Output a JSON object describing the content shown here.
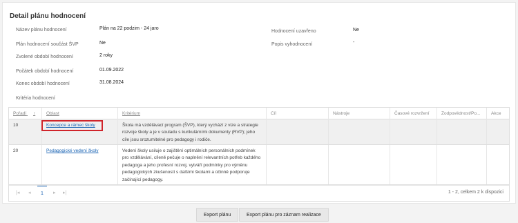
{
  "page": {
    "title": "Detail plánu hodnocení"
  },
  "details": {
    "nazev_label": "Název plánu hodnocení",
    "nazev_value": "Plán na 22 podzim - 24 jaro",
    "svp_label": "Plán hodnocení součást ŠVP",
    "svp_value": "Ne",
    "obdobi_label": "Zvolené období hodnocení",
    "obdobi_value": "2 roky",
    "pocatek_label": "Počátek období hodnocení",
    "pocatek_value": "01.09.2022",
    "konec_label": "Konec období hodnocení",
    "konec_value": "31.08.2024",
    "uzavreno_label": "Hodnocení uzavřeno",
    "uzavreno_value": "Ne",
    "popis_label": "Popis vyhodnocení",
    "popis_value": "-",
    "kriteria_label": "Kritéria hodnocení"
  },
  "table": {
    "columns": [
      "Pořadí",
      "Oblast",
      "Kritérium",
      "Cíl",
      "Nástroje",
      "Časové rozvržení",
      "Zodpovědnost/Po...",
      "Akce"
    ],
    "sort_icon": "↑",
    "rows": [
      {
        "poradi": "10",
        "oblast": "Koncepce a rámec školy",
        "kriterium": "Škola má vzdělávací program (ŠVP), který vychází z vize a strategie rozvoje školy a je v souladu s kurikulárními dokumenty (RVP); jeho cíle jsou srozumitelné pro pedagogy i rodiče."
      },
      {
        "poradi": "20",
        "oblast": "Pedagogické vedení školy",
        "kriterium": "Vedení školy usiluje o zajištění optimálních personálních podmínek pro vzdělávání, cíleně pečuje o naplnění relevantních potřeb každého pedagoga a jeho profesní rozvoj, vytváří podmínky pro výměnu pedagogických zkušeností s dalšími školami a účinně podporuje začínající pedagogy."
      }
    ]
  },
  "pager": {
    "first": "|◂",
    "prev": "◂",
    "page": "1",
    "next": "▸",
    "last": "▸|",
    "info": "1 - 2, celkem 2 k dispozici"
  },
  "buttons": {
    "export": "Export plánu",
    "export_realizace": "Export plánu pro záznam realizace"
  },
  "colors": {
    "link": "#1a64b4",
    "highlight": "#d0242b"
  }
}
